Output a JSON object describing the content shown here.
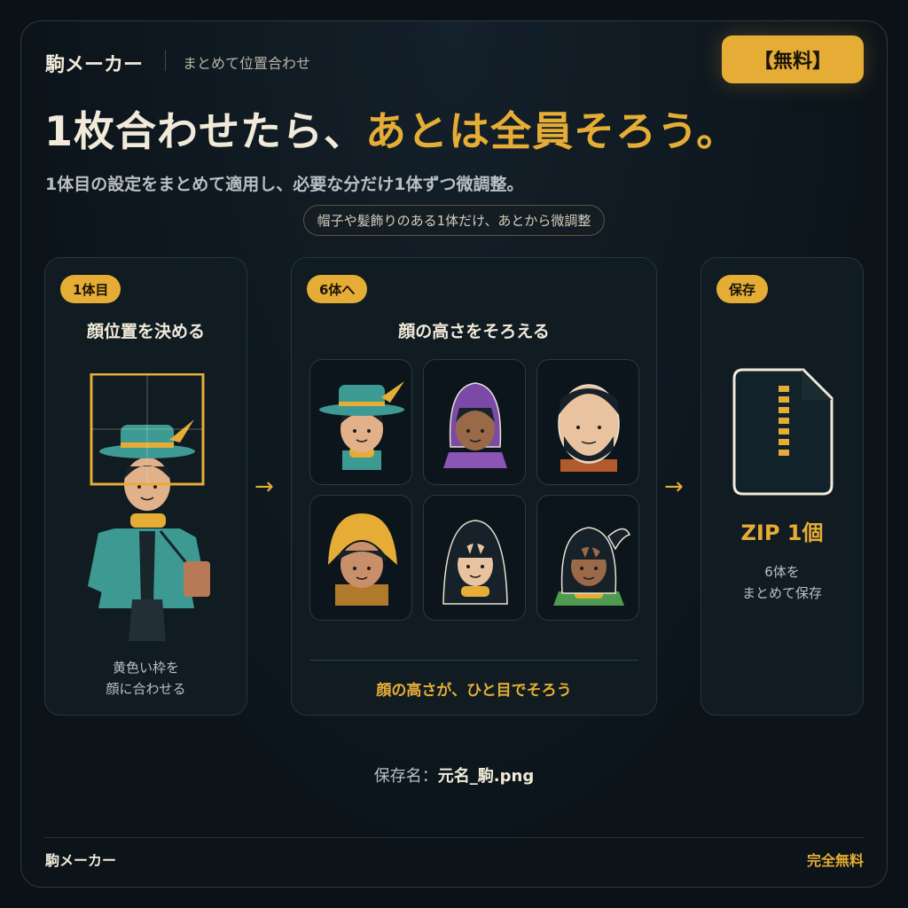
{
  "header": {
    "brand": "駒メーカー",
    "subtitle": "まとめて位置合わせ",
    "badge": "【無料】"
  },
  "hero": {
    "headline_part1": "1枚合わせたら、",
    "headline_part2": "あとは全員そろう。",
    "subline": "1体目の設定をまとめて適用し、必要な分だけ1体ずつ微調整。",
    "pill": "帽子や髪飾りのある1体だけ、あとから微調整"
  },
  "steps": {
    "step1": {
      "tag": "1体目",
      "title": "顔位置を決める",
      "note_line1": "黄色い枠を",
      "note_line2": "顔に合わせる"
    },
    "step2": {
      "tag": "6体へ",
      "title": "顔の高さをそろえる",
      "footer": "顔の高さが、ひと目でそろう"
    },
    "step3": {
      "tag": "保存",
      "title": "ZIP 1個",
      "note_line1": "6体を",
      "note_line2": "まとめて保存"
    },
    "arrow": "→"
  },
  "icons": [
    "zip-file-icon",
    "arrow-right-icon",
    "character-avatar-icon"
  ],
  "save": {
    "label": "保存名：",
    "value": "元名_駒.png"
  },
  "footer": {
    "brand": "駒メーカー",
    "free": "完全無料"
  },
  "colors": {
    "accent": "#e5ad35",
    "background": "#0b1217",
    "card": "#101b22",
    "text": "#f1ead9"
  }
}
